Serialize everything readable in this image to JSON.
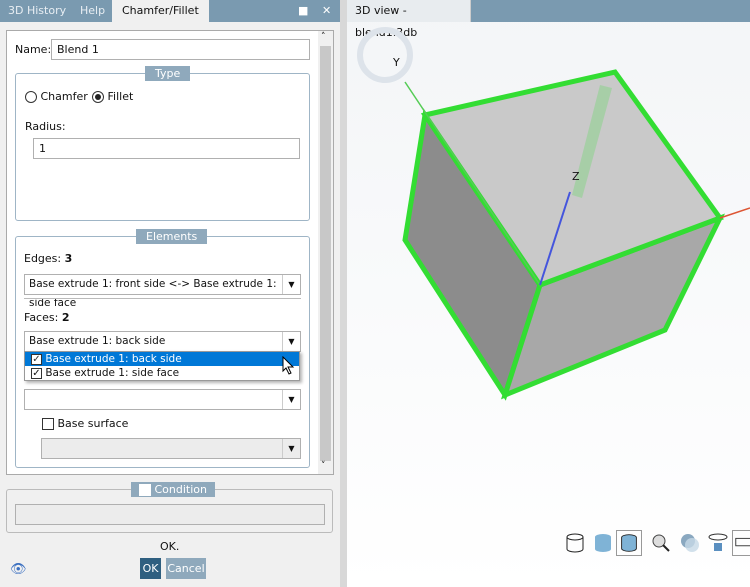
{
  "tabs": [
    {
      "label": "3D History"
    },
    {
      "label": "Help"
    },
    {
      "label": "Chamfer/Fillet"
    }
  ],
  "name": {
    "label": "Name:",
    "value": "Blend 1"
  },
  "type": {
    "legend": "Type",
    "chamfer": "Chamfer",
    "fillet": "Fillet",
    "selected": "Fillet",
    "radius_label": "Radius:",
    "radius_value": "1"
  },
  "elements": {
    "legend": "Elements",
    "edges_label": "Edges:",
    "edges_count": "3",
    "edges_value": "Base extrude 1: front side <-> Base extrude 1: side face",
    "faces_label": "Faces:",
    "faces_count": "2",
    "faces_value": "Base extrude 1: back side",
    "faces_dropdown": [
      {
        "label": "Base extrude 1: back side",
        "checked": true,
        "highlighted": true
      },
      {
        "label": "Base extrude 1: side face",
        "checked": true,
        "highlighted": false
      }
    ],
    "extra_combo": "",
    "base_surface_label": "Base surface",
    "base_surface_checked": false
  },
  "condition": {
    "label": "Condition",
    "checked": false,
    "value": ""
  },
  "status": "OK.",
  "buttons": {
    "ok": "OK",
    "cancel": "Cancel"
  },
  "view": {
    "title": "3D view - blend1.3db",
    "axis_y": "Y",
    "axis_z": "Z"
  },
  "colors": {
    "accent": "#0078d7",
    "tabbar": "#7a9ab0",
    "edge_highlight": "#33dd33"
  },
  "toolbar": [
    "wireframe-icon",
    "shaded-icon",
    "shaded-edges-icon",
    "zoom-fit-icon",
    "view-sphere-icon",
    "rotate-animation-icon",
    "keyboard-icon"
  ]
}
